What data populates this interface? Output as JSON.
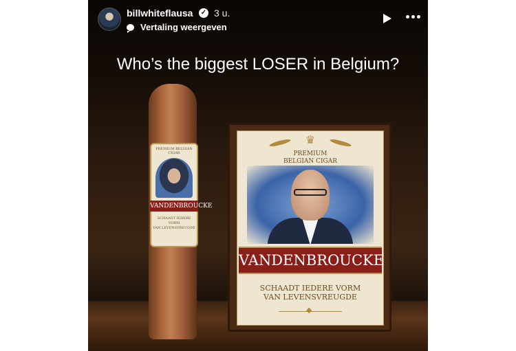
{
  "header": {
    "username": "billwhiteflausa",
    "verified_icon": "verified-badge-icon",
    "time": "3 u.",
    "translate_label": "Vertaling weergeven"
  },
  "controls": {
    "play_icon": "play-icon",
    "more_icon": "more-options-icon"
  },
  "post": {
    "headline": "Who’s the biggest LOSER in Belgium?",
    "cigar_band": {
      "top_text": "PREMIUM BELGIAN CIGAR",
      "name": "VANDENBROUCKE",
      "slogan_line1": "SCHAADT IEDERE VORM",
      "slogan_line2": "VAN LEVENSVREUGDE"
    },
    "box_label": {
      "premium_line1": "PREMIUM",
      "premium_line2": "BELGIAN CIGAR",
      "name": "VANDENBROUCKE",
      "slogan_line1": "SCHAADT IEDERE VORM",
      "slogan_line2": "VAN LEVENSVREUGDE"
    }
  },
  "colors": {
    "banner_red": "#8a1f1a",
    "label_cream": "#efe6d2",
    "gold": "#b28a3c"
  }
}
